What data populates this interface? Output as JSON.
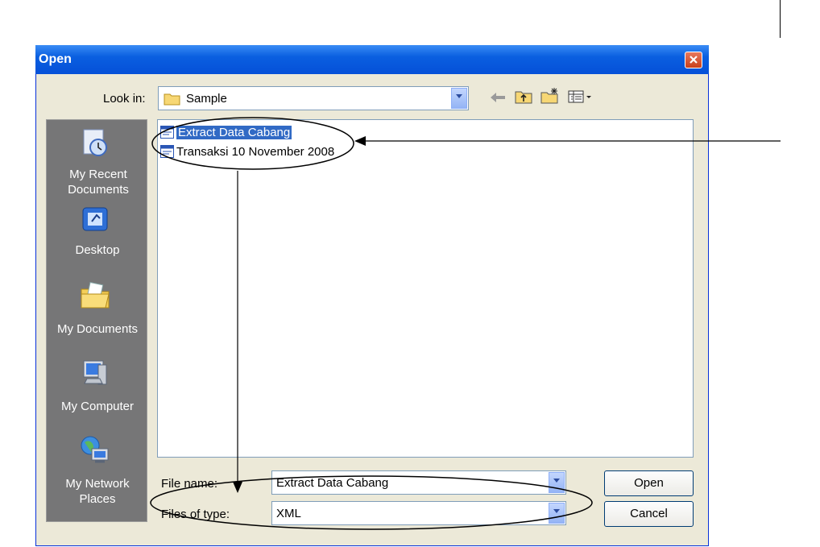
{
  "dialog": {
    "title": "Open"
  },
  "lookin": {
    "label": "Look in:",
    "value": "Sample"
  },
  "places": [
    {
      "label": "My Recent Documents",
      "icon": "recent-documents-icon"
    },
    {
      "label": "Desktop",
      "icon": "desktop-icon"
    },
    {
      "label": "My Documents",
      "icon": "my-documents-icon"
    },
    {
      "label": "My Computer",
      "icon": "my-computer-icon"
    },
    {
      "label": "My Network Places",
      "icon": "network-places-icon"
    }
  ],
  "files": [
    {
      "name": "Extract Data Cabang",
      "selected": true
    },
    {
      "name": "Transaksi 10 November 2008",
      "selected": false
    }
  ],
  "filename": {
    "label": "File name:",
    "value": "Extract Data Cabang"
  },
  "filetype": {
    "label": "Files of type:",
    "value": "XML"
  },
  "buttons": {
    "open": "Open",
    "cancel": "Cancel"
  }
}
